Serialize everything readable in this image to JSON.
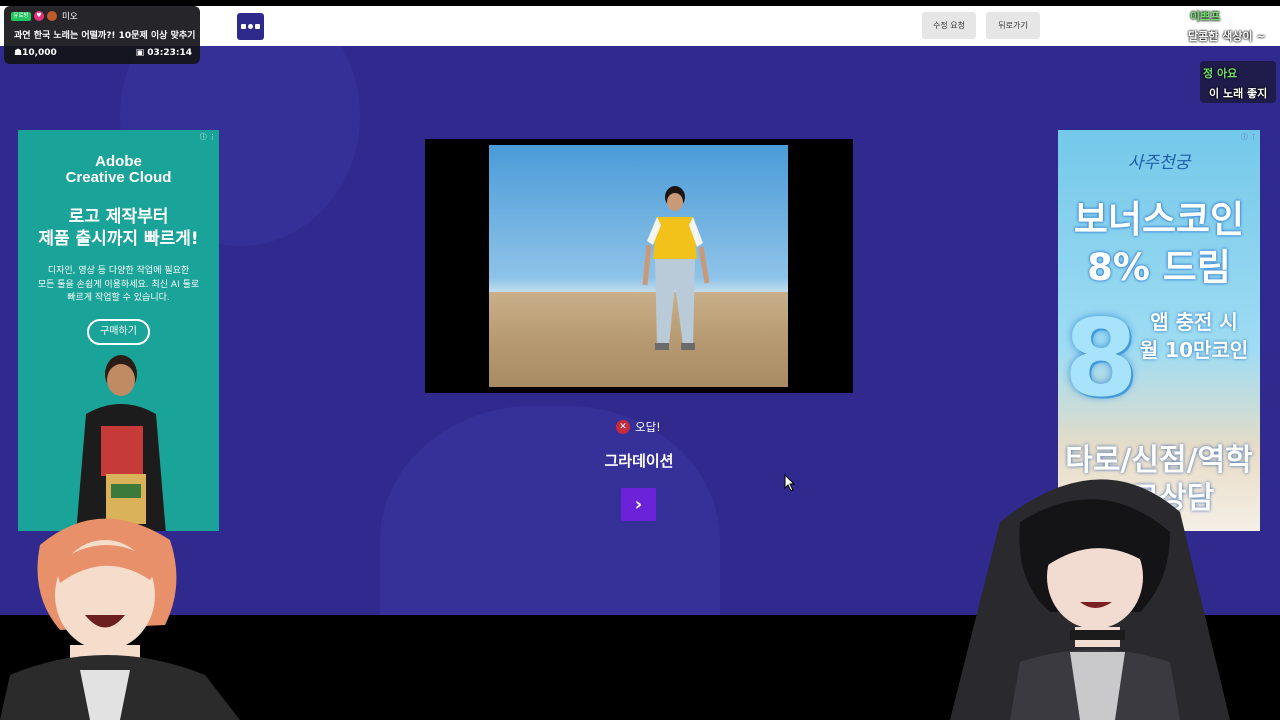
{
  "stream": {
    "tag": "유료방",
    "streamer": "미오",
    "title": "과연 한국 노래는 어떨까?! 10문제 이상 맞추기",
    "viewers": "10,000",
    "uptime": "03:23:14"
  },
  "toolbar": {
    "edit_request": "수정 요청",
    "back": "뒤로가기"
  },
  "chat": [
    {
      "name": "이쁘프",
      "message": "달콤한 색상이 ~"
    },
    {
      "name": "정 아요",
      "message": "이 노래 좋지"
    }
  ],
  "quiz": {
    "result_icon": "x-circle-icon",
    "result_label": "오답!",
    "answer": "그라데이션",
    "next_icon": "chevron-right-icon"
  },
  "ad_left": {
    "brand_line1": "Adobe",
    "brand_line2": "Creative Cloud",
    "headline_line1": "로고 제작부터",
    "headline_line2": "제품 출시까지 빠르게!",
    "body_line1": "디자인, 영상 등 다양한 작업에 필요한",
    "body_line2": "모든 툴을 손쉽게 이용하세요. 최신 AI 툴로",
    "body_line3": "빠르게 작업할 수 있습니다.",
    "cta": "구매하기"
  },
  "ad_right": {
    "brand": "사주천궁",
    "headline_line1": "보너스코인",
    "headline_line2": "8% 드림",
    "sub_line1": "앱 충전 시",
    "sub_line2": "월 10만코인",
    "big_number": "8",
    "bottom_line1": "타로/신점/역학",
    "bottom_line2": "무료상담"
  },
  "colors": {
    "stage": "#302a8e",
    "next_button": "#6c22d8",
    "wrong_badge": "#c62b3e",
    "ad_left_bg": "#1aa398"
  }
}
